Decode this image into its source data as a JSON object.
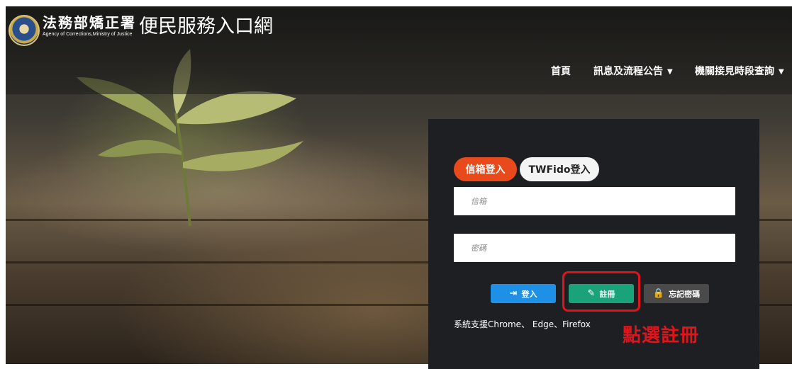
{
  "header": {
    "logo_icon": "agency-seal-icon",
    "brand_name": "法務部矯正署",
    "brand_subtitle": "Agency of Corrections,Ministry of Justice",
    "site_title": "便民服務入口網"
  },
  "nav": {
    "items": [
      {
        "label": "首頁",
        "has_dropdown": false
      },
      {
        "label": "訊息及流程公告",
        "has_dropdown": true
      },
      {
        "label": "機關接見時段查詢",
        "has_dropdown": true
      }
    ],
    "dropdown_icon": "caret-down-icon"
  },
  "login": {
    "tabs": [
      {
        "label": "信箱登入",
        "active": true
      },
      {
        "label": "TWFido登入",
        "active": false
      }
    ],
    "email_placeholder": "信箱",
    "password_placeholder": "密碼",
    "buttons": {
      "login": {
        "label": "登入",
        "icon": "sign-in-icon"
      },
      "register": {
        "label": "註冊",
        "icon": "register-icon"
      },
      "forgot": {
        "label": "忘記密碼",
        "icon": "password-lock-icon"
      }
    },
    "support_text": "系統支援Chrome、 Edge、Firefox"
  },
  "annotation": {
    "text": "點選註冊",
    "color": "#e0141a"
  },
  "colors": {
    "active_tab": "#e84a1c",
    "login_button": "#1e90e6",
    "register_button": "#1aa37a",
    "forgot_button": "#4a4a4a",
    "panel_background": "#1d1f23"
  }
}
